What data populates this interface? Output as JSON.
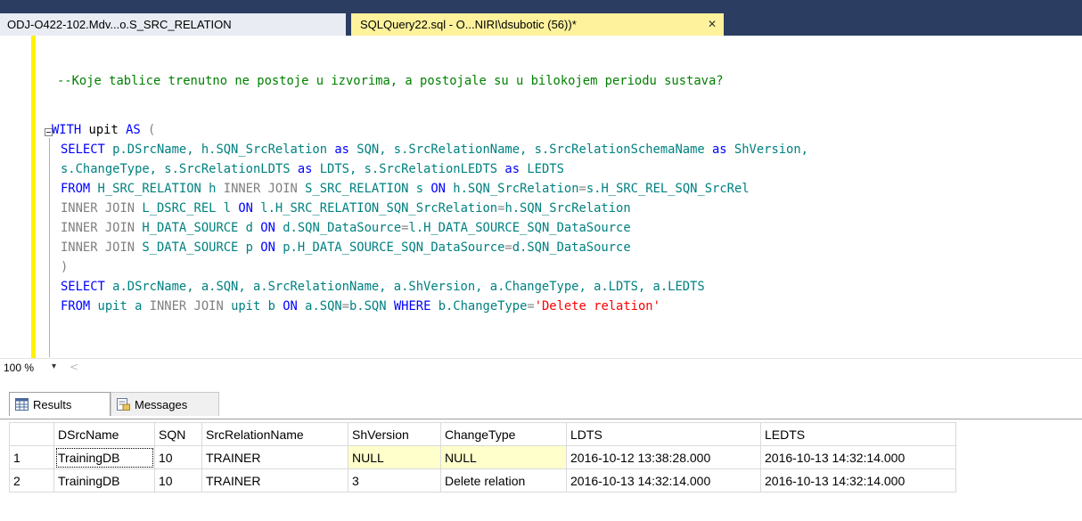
{
  "tabs": [
    {
      "label": "ODJ-O422-102.Mdv...o.S_SRC_RELATION",
      "active": false
    },
    {
      "label": "SQLQuery22.sql - O...NIRI\\dsubotic (56))*",
      "active": true,
      "close": "✕"
    }
  ],
  "editor": {
    "comment": "--Koje tablice trenutno ne postoje u izvorima, a postojale su u bilokojem periodu sustava?",
    "line_with": {
      "kw": "WITH",
      "name": " upit ",
      "kw2": "AS",
      "paren": " ("
    },
    "line1": {
      "a": "SELECT",
      "b": " p.DSrcName, h.SQN_SrcRelation ",
      "c": "as",
      "d": " SQN, s.SrcRelationName, s.SrcRelationSchemaName ",
      "e": "as",
      "f": " ShVersion,"
    },
    "line2": {
      "a": "s.ChangeType, s.SrcRelationLDTS ",
      "b": "as",
      "c": " LDTS, s.SrcRelationLEDTS ",
      "d": "as",
      "e": " LEDTS"
    },
    "line3": {
      "a": "FROM",
      "b": " H_SRC_RELATION h ",
      "c": "INNER JOIN",
      "d": " S_SRC_RELATION s ",
      "e": "ON",
      "f": " h.SQN_SrcRelation",
      "g": "=",
      "h": "s.H_SRC_REL_SQN_SrcRel"
    },
    "line4": {
      "a": "INNER JOIN",
      "b": " L_DSRC_REL l ",
      "c": "ON",
      "d": " l.H_SRC_RELATION_SQN_SrcRelation",
      "e": "=",
      "f": "h.SQN_SrcRelation"
    },
    "line5": {
      "a": "INNER JOIN",
      "b": " H_DATA_SOURCE d ",
      "c": "ON",
      "d": " d.SQN_DataSource",
      "e": "=",
      "f": "l.H_DATA_SOURCE_SQN_DataSource"
    },
    "line6": {
      "a": "INNER JOIN",
      "b": " S_DATA_SOURCE p ",
      "c": "ON",
      "d": " p.H_DATA_SOURCE_SQN_DataSource",
      "e": "=",
      "f": "d.SQN_DataSource"
    },
    "line7": ")",
    "line8": {
      "a": "SELECT",
      "b": " a.DSrcName, a.SQN, a.SrcRelationName, a.ShVersion, a.ChangeType, a.LDTS, a.LEDTS"
    },
    "line9": {
      "a": "FROM",
      "b": " upit a ",
      "c": "INNER JOIN",
      "d": " upit b ",
      "e": "ON",
      "f": " a.SQN",
      "g": "=",
      "h": "b.SQN ",
      "i": "WHERE",
      "j": " b.ChangeType",
      "k": "=",
      "l": "'Delete relation'"
    }
  },
  "zoom": {
    "label": "100 %",
    "arrow": "▾",
    "scroll": "<"
  },
  "results_tabs": {
    "results": "Results",
    "messages": "Messages"
  },
  "grid": {
    "columns": [
      "DSrcName",
      "SQN",
      "SrcRelationName",
      "ShVersion",
      "ChangeType",
      "LDTS",
      "LEDTS"
    ],
    "rows": [
      {
        "num": "1",
        "cells": [
          "TrainingDB",
          "10",
          "TRAINER",
          "NULL",
          "NULL",
          "2016-10-12 13:38:28.000",
          "2016-10-13 14:32:14.000"
        ]
      },
      {
        "num": "2",
        "cells": [
          "TrainingDB",
          "10",
          "TRAINER",
          "3",
          "Delete relation",
          "2016-10-13 14:32:14.000",
          "2016-10-13 14:32:14.000"
        ]
      }
    ]
  },
  "colors": {
    "tabstrip": "#2b3d61",
    "active_tab": "#fff29d",
    "margin": "#fff200",
    "keyword": "#0000ff",
    "comment": "#008000",
    "string": "#ff0000",
    "null_cell": "#ffffcc"
  }
}
